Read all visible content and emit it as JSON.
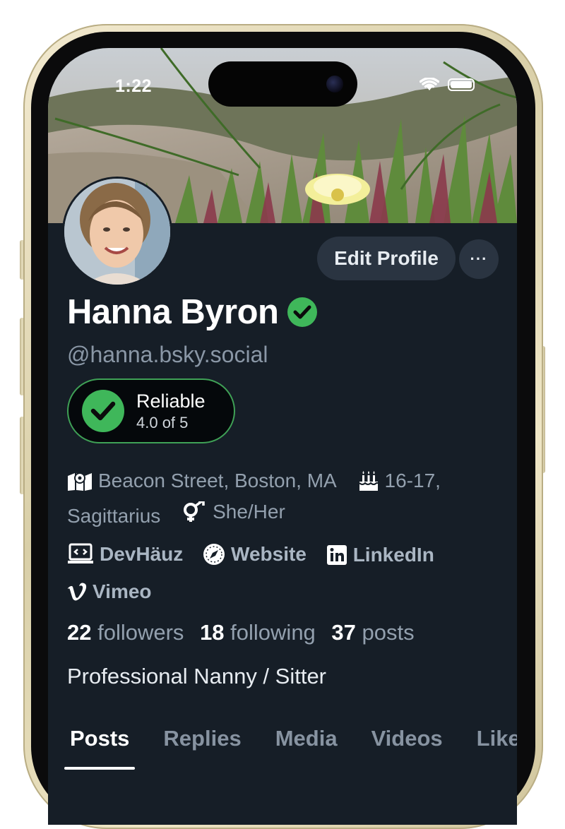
{
  "status_bar": {
    "time": "1:22"
  },
  "profile": {
    "display_name": "Hanna Byron",
    "handle": "@hanna.bsky.social",
    "edit_button": "Edit Profile",
    "more_button": "···",
    "verified_color": "#3fb75a"
  },
  "badge": {
    "title": "Reliable",
    "subtitle": "4.0 of 5"
  },
  "meta": {
    "location": "Beacon Street, Boston, MA",
    "birthday": "16-17,",
    "zodiac": "Sagittarius",
    "pronouns": "She/Her"
  },
  "links": [
    {
      "label": "DevHäuz",
      "icon": "code-laptop-icon"
    },
    {
      "label": "Website",
      "icon": "compass-icon"
    },
    {
      "label": "LinkedIn",
      "icon": "linkedin-icon"
    },
    {
      "label": "Vimeo",
      "icon": "vimeo-icon"
    }
  ],
  "stats": {
    "followers_count": "22",
    "followers_label": "followers",
    "following_count": "18",
    "following_label": "following",
    "posts_count": "37",
    "posts_label": "posts"
  },
  "bio": "Professional Nanny / Sitter",
  "tabs": [
    {
      "label": "Posts",
      "active": true
    },
    {
      "label": "Replies"
    },
    {
      "label": "Media"
    },
    {
      "label": "Videos"
    },
    {
      "label": "Likes"
    }
  ]
}
